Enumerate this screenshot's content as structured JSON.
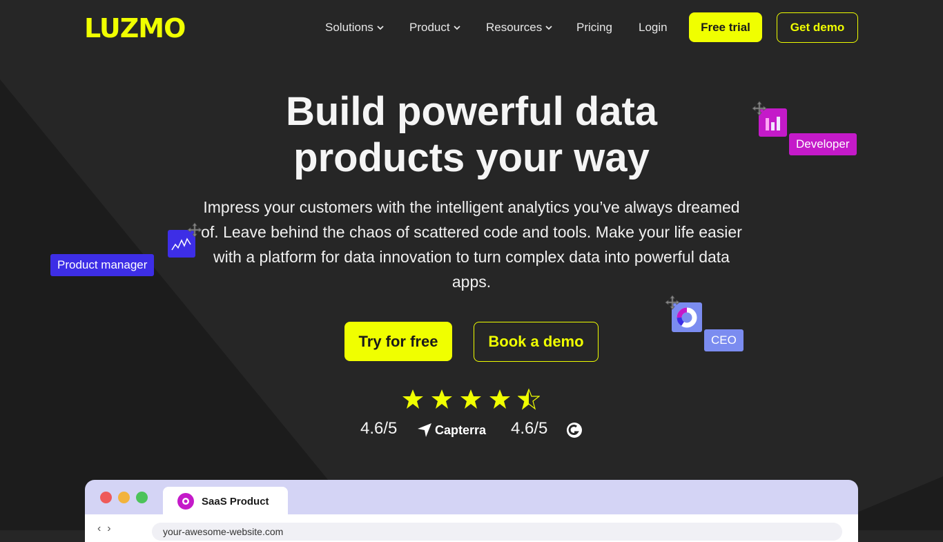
{
  "nav": {
    "logo": "LUZMO",
    "items": [
      {
        "label": "Solutions",
        "has_dropdown": true
      },
      {
        "label": "Product",
        "has_dropdown": true
      },
      {
        "label": "Resources",
        "has_dropdown": true
      },
      {
        "label": "Pricing",
        "has_dropdown": false
      },
      {
        "label": "Login",
        "has_dropdown": false
      }
    ],
    "free_trial": "Free trial",
    "get_demo": "Get demo"
  },
  "hero": {
    "title_line1": "Build powerful data",
    "title_line2": "products your way",
    "subtitle": "Impress your customers with the intelligent analytics you’ve always dreamed of. Leave behind the chaos of scattered code and tools. Make your life easier with a platform for data innovation to turn complex data into powerful data apps.",
    "try_free": "Try for free",
    "book_demo": "Book a demo"
  },
  "persona_tags": {
    "developer": "Developer",
    "product_manager": "Product manager",
    "ceo": "CEO"
  },
  "ratings": {
    "stars": 4.5,
    "capterra_score": "4.6/5",
    "capterra_name": "Capterra",
    "g2_score": "4.6/5"
  },
  "browser": {
    "tab_title": "SaaS Product",
    "url": "your-awesome-website.com"
  },
  "colors": {
    "accent": "#f0ff00",
    "background": "#262626",
    "developer_tag": "#c41ac9",
    "product_manager_tag": "#3d2ee6",
    "ceo_tag": "#7b8cf0"
  }
}
